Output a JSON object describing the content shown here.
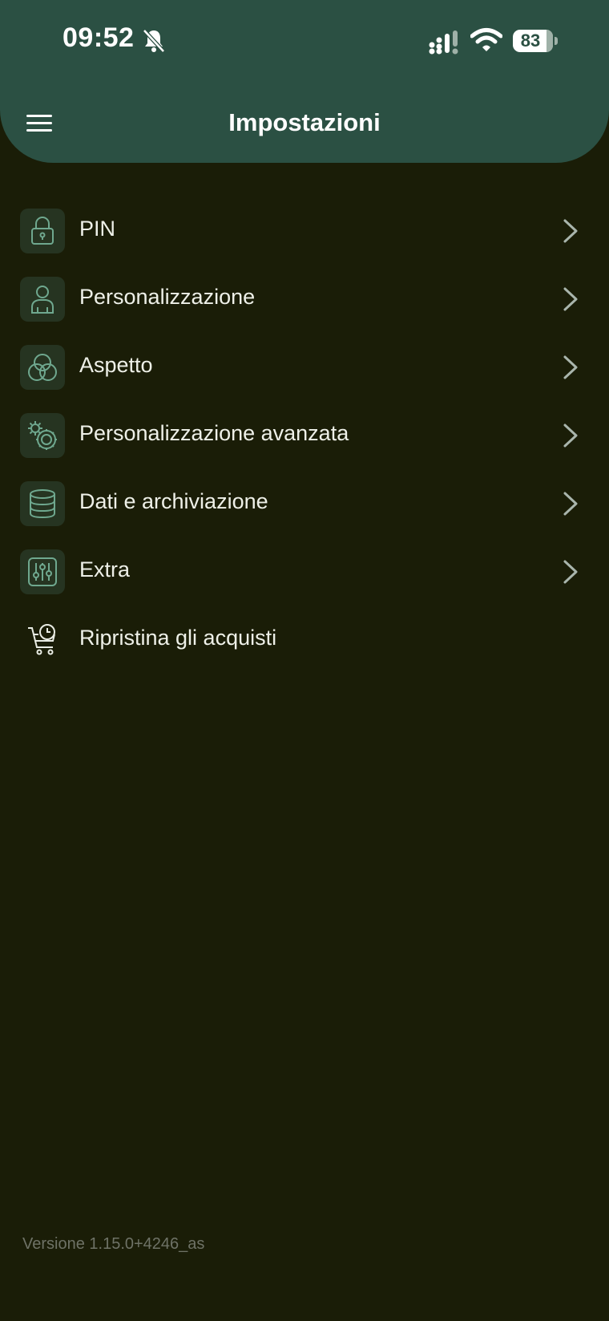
{
  "status_bar": {
    "time": "09:52",
    "battery": "83"
  },
  "header": {
    "title": "Impostazioni"
  },
  "settings": {
    "items": [
      {
        "label": "PIN",
        "icon": "lock-icon"
      },
      {
        "label": "Personalizzazione",
        "icon": "person-icon"
      },
      {
        "label": "Aspetto",
        "icon": "color-circles-icon"
      },
      {
        "label": "Personalizzazione avanzata",
        "icon": "gears-icon"
      },
      {
        "label": "Dati e archiviazione",
        "icon": "database-icon"
      },
      {
        "label": "Extra",
        "icon": "sliders-icon"
      },
      {
        "label": "Ripristina gli acquisti",
        "icon": "cart-clock-icon"
      }
    ]
  },
  "footer": {
    "version": "Versione 1.15.0+4246_as"
  },
  "colors": {
    "header_bg": "#2b5043",
    "page_bg": "#1a1d07",
    "icon_tile_bg": "#263421",
    "icon_stroke": "#6fa88f",
    "text": "#eef0e8",
    "version_text": "#6e7266"
  }
}
